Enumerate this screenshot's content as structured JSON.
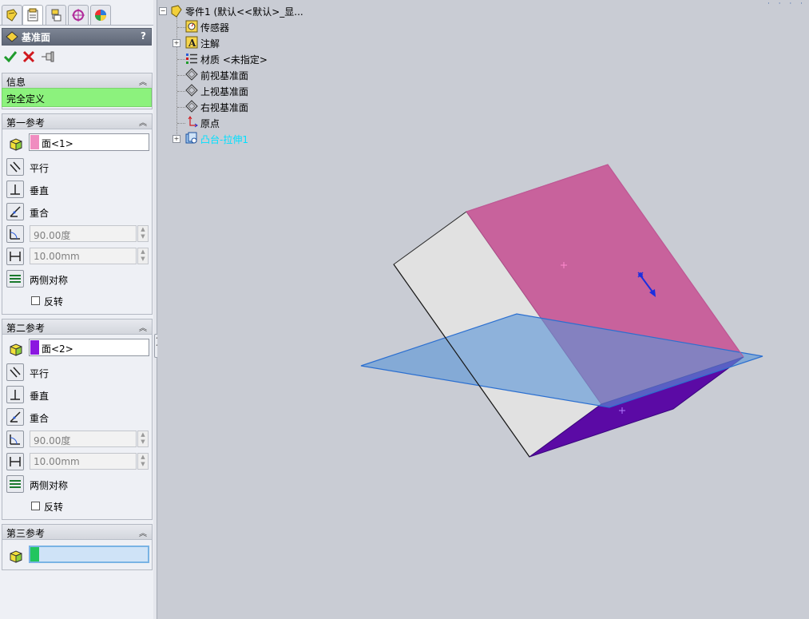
{
  "property_manager": {
    "title": "基准面",
    "help": "?",
    "tabs": [
      "feature-manager-tab",
      "property-manager-tab",
      "configuration-manager-tab",
      "dimxpert-tab",
      "display-manager-tab"
    ],
    "info_group": {
      "label": "信息",
      "status": "完全定义",
      "status_color": "#8cf27d"
    },
    "first_reference": {
      "label": "第一参考",
      "selection": "面<1>",
      "swatch_color": "#f08cc0",
      "options": {
        "parallel": "平行",
        "perpendicular": "垂直",
        "coincident": "重合",
        "mid_plane": "两侧对称",
        "flip": "反转"
      },
      "angle": "90.00度",
      "distance": "10.00mm"
    },
    "second_reference": {
      "label": "第二参考",
      "selection": "面<2>",
      "swatch_color": "#8b17e0",
      "options": {
        "parallel": "平行",
        "perpendicular": "垂直",
        "coincident": "重合",
        "mid_plane": "两侧对称",
        "flip": "反转"
      },
      "angle": "90.00度",
      "distance": "10.00mm"
    },
    "third_reference": {
      "label": "第三参考",
      "selection": "",
      "swatch_color": "#22c55e"
    }
  },
  "feature_tree": {
    "root": "零件1 (默认<<默认>_显...",
    "items": [
      {
        "label": "传感器",
        "icon": "sensor-icon"
      },
      {
        "label": "注解",
        "icon": "annotation-icon",
        "expandable": true
      },
      {
        "label": "材质 <未指定>",
        "icon": "material-icon"
      },
      {
        "label": "前视基准面",
        "icon": "plane-icon"
      },
      {
        "label": "上视基准面",
        "icon": "plane-icon"
      },
      {
        "label": "右视基准面",
        "icon": "plane-icon"
      },
      {
        "label": "原点",
        "icon": "origin-icon"
      },
      {
        "label": "凸台-拉伸1",
        "icon": "extrude-icon",
        "expandable": true,
        "color": "#00e0ff"
      }
    ]
  },
  "scene_colors": {
    "face_top": "#c8629c",
    "face_left": "#e1e1e1",
    "face_bottom": "#5b0aa5",
    "plane_fill": "#5b95d6",
    "plane_edge": "#2b6fd0"
  }
}
